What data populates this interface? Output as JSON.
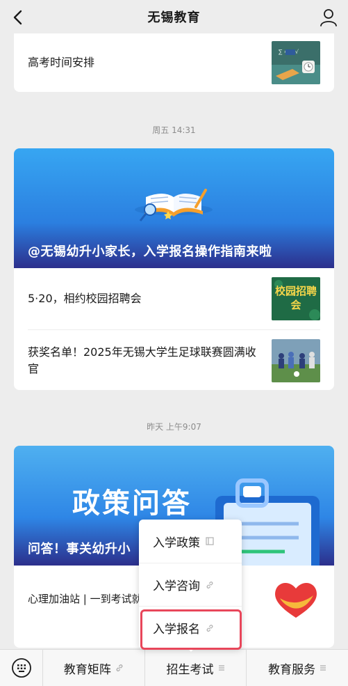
{
  "header": {
    "title": "无锡教育"
  },
  "feed": {
    "top_card": {
      "article": "高考时间安排"
    },
    "group1": {
      "timestamp": "周五 14:31",
      "banner_caption": "@无锡幼升小家长，入学报名操作指南来啦",
      "articles": [
        {
          "title": "5·20，相约校园招聘会",
          "thumb_text": "校园招聘会"
        },
        {
          "title": "获奖名单！2025年无锡大学生足球联赛圆满收官"
        }
      ]
    },
    "group2": {
      "timestamp": "昨天 上午9:07",
      "banner_big_text": "政策问答",
      "banner_caption": "问答！事关幼升小",
      "article": "心理加油站 | 一到考试就紧张，怎么办？"
    }
  },
  "popup_menu": {
    "items": [
      {
        "label": "入学政策",
        "icon": "document-icon"
      },
      {
        "label": "入学咨询",
        "icon": "link-icon"
      },
      {
        "label": "入学报名",
        "icon": "link-icon"
      }
    ],
    "highlighted_index": 2,
    "highlight_color": "#e8465a"
  },
  "bottom_nav": {
    "items": [
      {
        "label": "教育矩阵",
        "icon": "link-icon"
      },
      {
        "label": "招生考试",
        "icon": "menu-icon"
      },
      {
        "label": "教育服务",
        "icon": "menu-icon"
      }
    ]
  },
  "colors": {
    "background": "#ededed",
    "banner_blue": "#2f8ee8",
    "banner_dark": "#2c2f8c"
  }
}
